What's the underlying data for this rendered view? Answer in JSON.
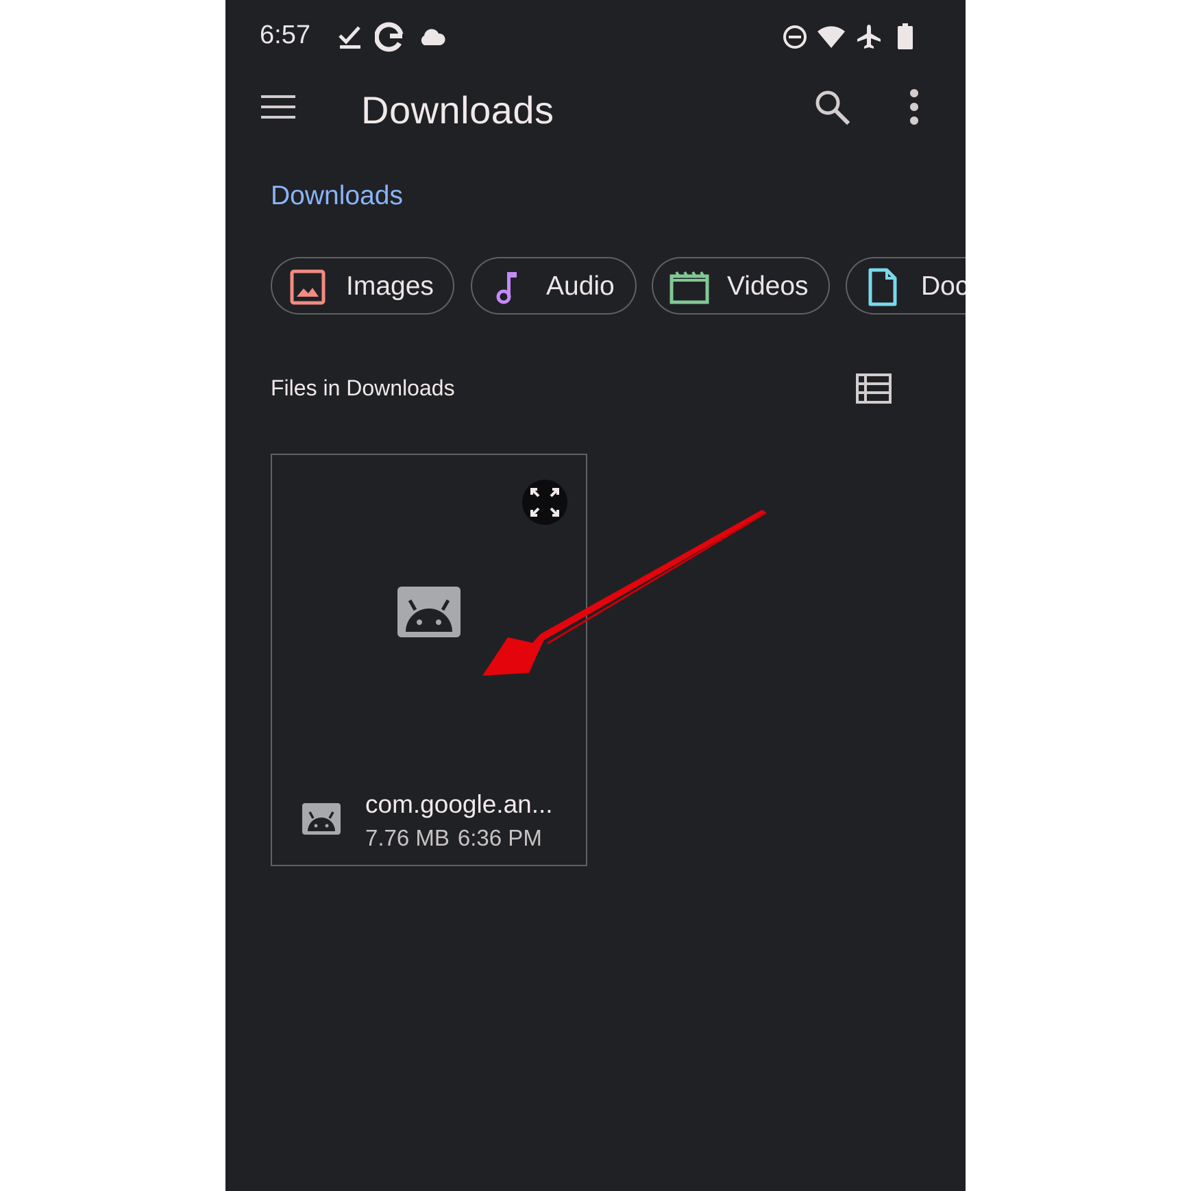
{
  "status_bar": {
    "time": "6:57",
    "left_icons": [
      "checkmark-download-icon",
      "google-icon",
      "cloud-icon"
    ],
    "right_icons": [
      "do-not-disturb-icon",
      "wifi-icon",
      "airplane-mode-icon",
      "battery-icon"
    ]
  },
  "app_bar": {
    "title": "Downloads",
    "icons": [
      "hamburger-menu-icon",
      "search-icon",
      "more-vert-icon"
    ]
  },
  "breadcrumb": "Downloads",
  "chips": [
    {
      "label": "Images",
      "icon": "image-icon",
      "color": "#f28b82"
    },
    {
      "label": "Audio",
      "icon": "music-note-icon",
      "color": "#c58af9"
    },
    {
      "label": "Videos",
      "icon": "movie-clapper-icon",
      "color": "#81c995"
    },
    {
      "label": "Doc",
      "icon": "document-icon",
      "color": "#78d9ec"
    }
  ],
  "section": {
    "title": "Files in Downloads",
    "view_toggle_icon": "list-view-icon"
  },
  "file": {
    "name": "com.google.an...",
    "size": "7.76 MB",
    "time": "6:36 PM",
    "type_icon": "android-apk-icon",
    "expand_icon": "fullscreen-icon"
  },
  "colors": {
    "background": "#202125",
    "accent": "#8ab4f8",
    "annotation_arrow": "#e3040c"
  }
}
